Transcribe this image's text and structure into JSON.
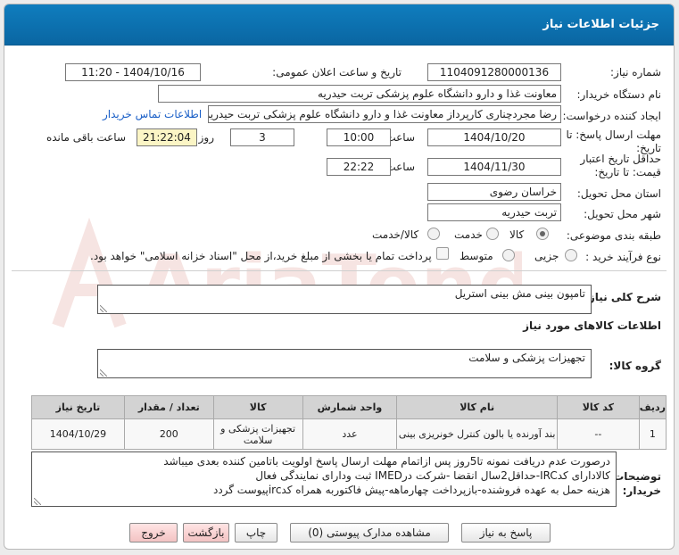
{
  "header": {
    "title": "جزئیات اطلاعات نیاز"
  },
  "fields": {
    "need_number_label": "شماره نیاز:",
    "need_number": "1104091280000136",
    "announce_label": "تاریخ و ساعت اعلان عمومی:",
    "announce_value": "1404/10/16 - 11:20",
    "buyer_label": "نام دستگاه خریدار:",
    "buyer_value": "معاونت غذا و دارو   دانشگاه علوم پزشکی تربت حیدریه",
    "creator_label": "ایجاد کننده درخواست:",
    "creator_value": "رضا مجردچناری کارپرداز معاونت غذا و دارو   دانشگاه علوم پزشکی تربت حیدریه",
    "contact_link": "اطلاعات تماس خریدار",
    "deadline_label": "مهلت ارسال پاسخ: تا تاریخ:",
    "deadline_date": "1404/10/20",
    "time_label": "ساعت",
    "deadline_time": "10:00",
    "days_value": "3",
    "days_and": "روز و",
    "remaining_time": "21:22:04",
    "remaining_label": "ساعت باقی مانده",
    "validity_label": "حداقل تاریخ اعتبار قیمت: تا تاریخ:",
    "validity_date": "1404/11/30",
    "validity_time": "22:22",
    "province_label": "استان محل تحویل:",
    "province_value": "خراسان رضوی",
    "city_label": "شهر محل تحویل:",
    "city_value": "تربت حیدریه",
    "category_label": "طبقه بندی موضوعی:",
    "category_options": [
      "کالا",
      "خدمت",
      "کالا/خدمت"
    ],
    "process_label": "نوع فرآیند خرید :",
    "process_options": [
      "جزیی",
      "متوسط"
    ],
    "payment_note": "پرداخت تمام یا بخشی از مبلغ خرید،از محل \"اسناد خزانه اسلامی\" خواهد بود."
  },
  "summary": {
    "label": "شرح کلی نیاز:",
    "value": "تامپون بینی مش بینی استریل"
  },
  "goods": {
    "section_title": "اطلاعات کالاهای مورد نیاز",
    "group_label": "گروه کالا:",
    "group_value": "تجهیزات پزشکی و سلامت"
  },
  "table": {
    "headers": [
      "ردیف",
      "کد کالا",
      "نام کالا",
      "واحد شمارش",
      "کالا",
      "تعداد / مقدار",
      "تاریخ نیاز"
    ],
    "rows": [
      [
        "1",
        "--",
        "بند آورنده یا بالون کنترل خونریزی بینی",
        "عدد",
        "تجهیزات پزشکی و سلامت",
        "200",
        "1404/10/29"
      ]
    ]
  },
  "notes": {
    "label": "توضیحات خریدار:",
    "lines": [
      "درصورت عدم دریافت نمونه تا5روز پس ازاتمام مهلت ارسال پاسخ اولویت باتامین کننده بعدی میباشد",
      "کالادارای کدIRC-حداقل2سال انقضا -شرکت درIMED ثبت ودارای نمایندگی فعال",
      "هزینه حمل به عهده فروشنده-بازپرداخت چهارماهه-پیش فاکتوربه همراه کدircپیوست گردد"
    ]
  },
  "buttons": {
    "reply": "پاسخ به نیاز",
    "attachments": "مشاهده مدارک پیوستی (0)",
    "print": "چاپ",
    "back": "بازگشت",
    "exit": "خروج"
  },
  "watermark": {
    "text": "AriaTender.net"
  },
  "colors": {
    "header": "#0a6fae",
    "link": "#1a5fc7",
    "highlight": "#fbf5c5"
  }
}
